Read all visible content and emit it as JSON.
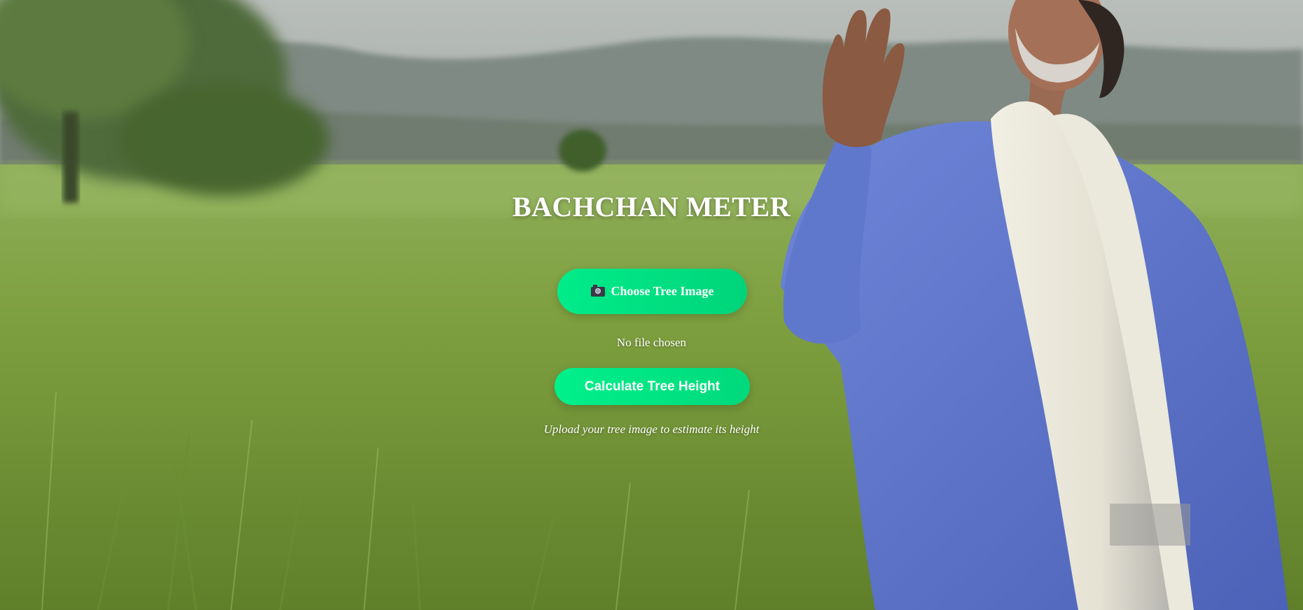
{
  "header": {
    "title": "BACHCHAN METER"
  },
  "upload": {
    "icon": "camera-icon",
    "choose_label": "Choose Tree Image",
    "file_status": "No file chosen"
  },
  "actions": {
    "calculate_label": "Calculate Tree Height"
  },
  "footer": {
    "hint": "Upload your tree image to estimate its height"
  },
  "colors": {
    "button_gradient_start": "#00ec8a",
    "button_gradient_end": "#00d47a",
    "text": "#ffffff"
  }
}
